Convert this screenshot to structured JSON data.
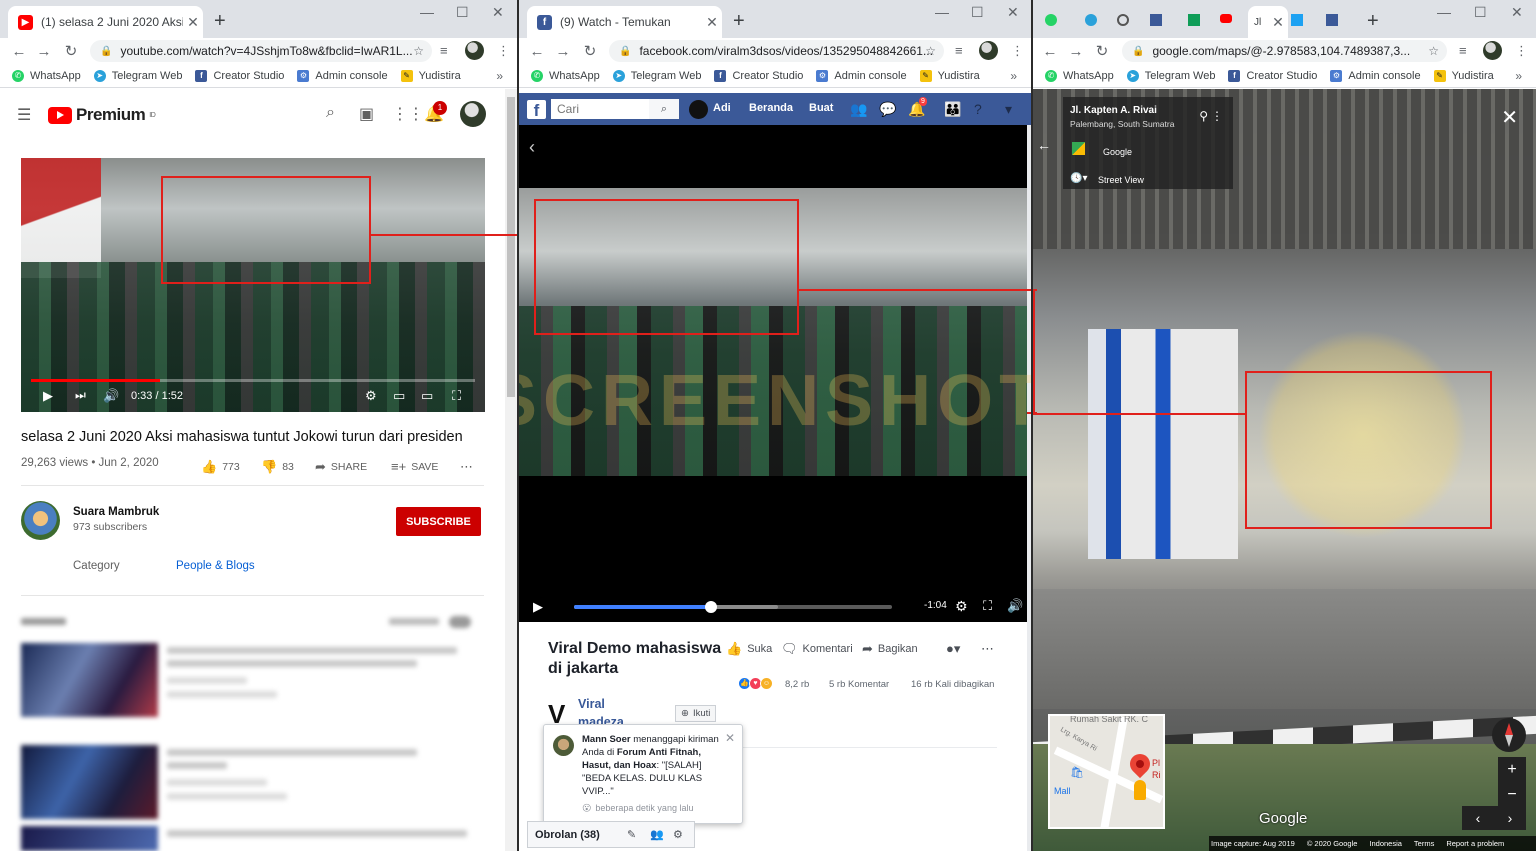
{
  "youtube_window": {
    "tab_title": "(1) selasa 2 Juni 2020 Aksi maha...",
    "url": "youtube.com/watch?v=4JSshjmTo8w&fbclid=IwAR1L...",
    "logo": "Premium",
    "logo_region": "ID",
    "notif_count": "1",
    "video": {
      "time": "0:33 / 1:52",
      "progress_fraction": 0.29,
      "title": "selasa 2 Juni 2020 Aksi mahasiswa tuntut Jokowi turun dari presiden",
      "meta": "29,263 views • Jun 2, 2020",
      "likes": "773",
      "dislikes": "83",
      "share": "SHARE",
      "save": "SAVE"
    },
    "channel": {
      "name": "Suara Mambruk",
      "subscribers": "973 subscribers",
      "subscribe_label": "SUBSCRIBE"
    },
    "category_label": "Category",
    "category_value": "People & Blogs"
  },
  "facebook_window": {
    "tab_title": "(9) Watch - Temukan",
    "url": "facebook.com/viralm3dsos/videos/135295048842661...",
    "search_placeholder": "Cari",
    "nav": {
      "user": "Adi",
      "home": "Beranda",
      "create": "Buat"
    },
    "notif_count": "9",
    "video": {
      "remaining": "-1:04",
      "progress_fraction": 0.43,
      "buffer_fraction": 0.64
    },
    "post": {
      "title": "Viral Demo mahasiswa di jakarta",
      "like": "Suka",
      "comment": "Komentari",
      "share": "Bagikan",
      "reactions": "8,2 rb",
      "comments_count": "5 rb Komentar",
      "shares_count": "16 rb Kali dibagikan",
      "page_name": "Viral madeza",
      "follow": "Ikuti"
    },
    "notification": {
      "text_1": "Mann Soer",
      "text_2": " menanggapi kiriman Anda di ",
      "text_3": "Forum Anti Fitnah, Hasut, dan Hoax",
      "text_4": ": \"[SALAH] \"BEDA KELAS. DULU KLAS VVIP...\"",
      "time": "beberapa detik yang lalu"
    },
    "chat_label": "Obrolan (38)"
  },
  "maps_window": {
    "url": "google.com/maps/@-2.978583,104.7489387,3...",
    "place": "Jl. Kapten A. Rivai",
    "place_sub": "Palembang, South Sumatra",
    "provider": "Google",
    "view_label": "Street View",
    "minimap_labels": [
      "Rumah Sakit RK. C",
      "Lrg. Karya Ri",
      "Mall",
      "Pl",
      "Ri"
    ],
    "brand": "Google",
    "footer": [
      "Image capture: Aug 2019",
      "© 2020 Google",
      "Indonesia",
      "Terms",
      "Report a problem"
    ]
  },
  "bookmarks": [
    "WhatsApp",
    "Telegram Web",
    "Creator Studio",
    "Admin console",
    "Yudistira"
  ],
  "watermark_text": "SCREENSHOT",
  "colors": {
    "annotation_red": "#e0201b",
    "yt_red": "#ff0000",
    "fb_blue": "#3b5998",
    "fb_progress": "#4080ff"
  }
}
